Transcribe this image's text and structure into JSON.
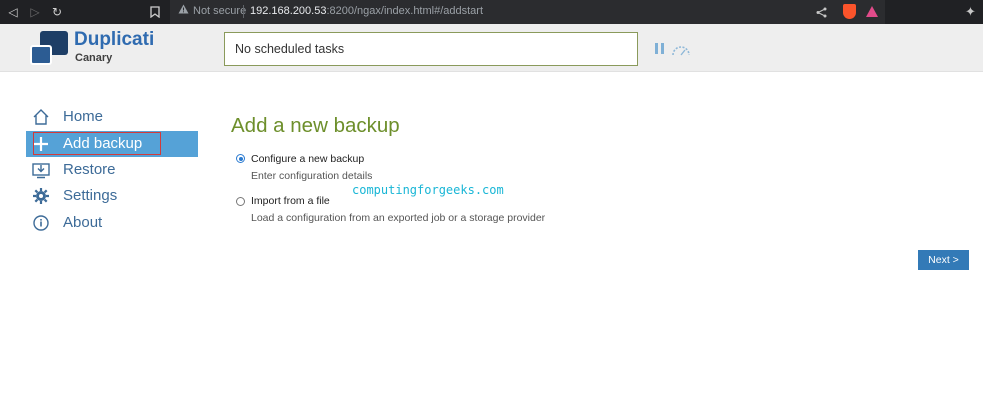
{
  "browser": {
    "back_icon": "back-icon",
    "forward_icon": "forward-icon",
    "reload_icon": "reload-icon",
    "bookmark_icon": "bookmark-icon",
    "warning_icon": "warning-icon",
    "not_secure": "Not secure",
    "url_host": "192.168.200.53",
    "url_path": ":8200/ngax/index.html#/addstart",
    "share_icon": "share-icon",
    "brave_shield_icon": "brave-shield-icon",
    "brave_rewards_icon": "brave-rewards-icon",
    "extensions_icon": "puzzle-icon"
  },
  "header": {
    "brand_title": "Duplicati",
    "brand_subtitle": "Canary",
    "status_text": "No scheduled tasks",
    "pause_icon": "pause-icon",
    "throttle_icon": "speed-gauge-icon"
  },
  "sidebar": {
    "items": [
      {
        "label": "Home",
        "icon": "home-icon",
        "active": false
      },
      {
        "label": "Add backup",
        "icon": "plus-icon",
        "active": true
      },
      {
        "label": "Restore",
        "icon": "restore-icon",
        "active": false
      },
      {
        "label": "Settings",
        "icon": "gear-icon",
        "active": false
      },
      {
        "label": "About",
        "icon": "info-icon",
        "active": false
      }
    ],
    "accent": "#55a2d7"
  },
  "main": {
    "title": "Add a new backup",
    "options": [
      {
        "label": "Configure a new backup",
        "description": "Enter configuration details",
        "selected": true
      },
      {
        "label": "Import from a file",
        "description": "Load a configuration from an exported job or a storage provider",
        "selected": false
      }
    ],
    "watermark": "computingforgeeks.com",
    "next_label": "Next >"
  },
  "colors": {
    "title_green": "#6d8f2b",
    "button_blue": "#337ab7",
    "brand_blue": "#2f6bb0"
  }
}
